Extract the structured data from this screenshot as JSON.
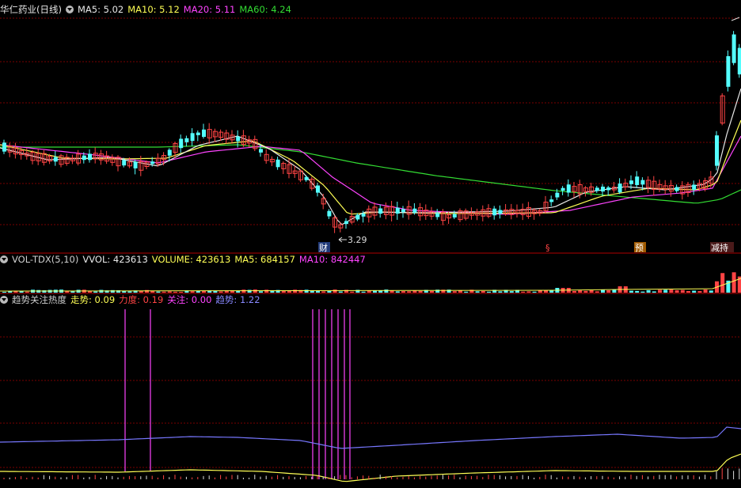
{
  "colors": {
    "background": "#000000",
    "grid": "#7a0000",
    "up": "#ff4444",
    "down": "#54ffff",
    "ma5": "#e8e8e8",
    "ma10": "#ffff55",
    "ma20": "#ff44ff",
    "ma60": "#33dd33",
    "trend_line": "#7777ff",
    "strength_line": "#ffff55",
    "focus_bar": "#ff44ff"
  },
  "main_panel": {
    "title": "华仁药业(日线)",
    "ma5_label": "MA5: 5.02",
    "ma10_label": "MA10: 5.12",
    "ma20_label": "MA20: 5.11",
    "ma60_label": "MA60: 4.24",
    "low_marker_text": "3.29",
    "event_labels": [
      "财",
      "§",
      "预",
      "减持"
    ]
  },
  "volume_panel": {
    "name_label": "VOL-TDX(5,10)",
    "vvol_label": "VVOL: 423613",
    "volume_label": "VOLUME: 423613",
    "ma5_label": "MA5: 684157",
    "ma10_label": "MA10: 842447"
  },
  "indicator_panel": {
    "name_label": "趋势关注热度",
    "trend_walk_label": "走势: 0.09",
    "strength_label": "力度: 0.19",
    "focus_label": "关注: 0.00",
    "trend_label": "趋势: 1.22"
  }
}
